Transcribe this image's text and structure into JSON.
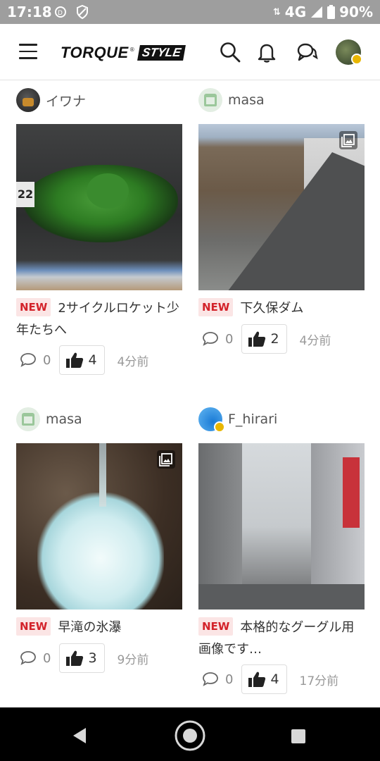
{
  "status": {
    "time": "17:18",
    "network": "4G",
    "battery": "90%"
  },
  "header": {
    "logo_main": "TORQUE",
    "logo_sub": "STYLE"
  },
  "posts": [
    {
      "author": "イワナ",
      "new_label": "NEW",
      "title": "2サイクルロケット少年たちへ",
      "comments": "0",
      "likes": "4",
      "ago": "4分前"
    },
    {
      "author": "masa",
      "new_label": "NEW",
      "title": "下久保ダム",
      "comments": "0",
      "likes": "2",
      "ago": "4分前"
    },
    {
      "author": "masa",
      "new_label": "NEW",
      "title": "早滝の氷瀑",
      "comments": "0",
      "likes": "3",
      "ago": "9分前"
    },
    {
      "author": "F_hirari",
      "new_label": "NEW",
      "title": "本格的なグーグル用画像です…",
      "comments": "0",
      "likes": "4",
      "ago": "17分前"
    }
  ]
}
